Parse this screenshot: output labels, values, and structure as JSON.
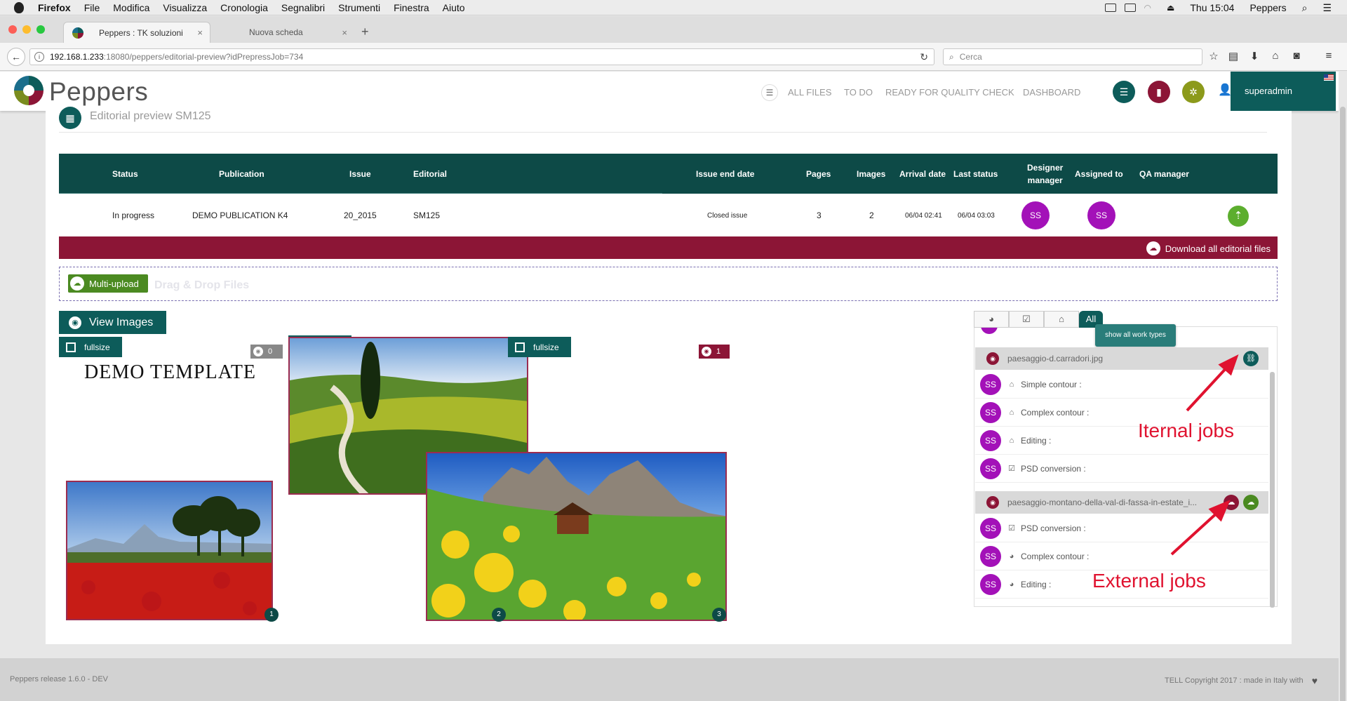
{
  "menubar": {
    "app": "Firefox",
    "items": [
      "File",
      "Modifica",
      "Visualizza",
      "Cronologia",
      "Segnalibri",
      "Strumenti",
      "Finestra",
      "Aiuto"
    ],
    "clock": "Thu 15:04",
    "user": "Peppers"
  },
  "browser": {
    "tabs": [
      {
        "label": "Peppers : TK soluzioni",
        "close": "×"
      },
      {
        "label": "Nuova scheda",
        "close": "×"
      }
    ],
    "new_tab": "+",
    "url_host": "192.168.1.233",
    "url_path": ":18080/peppers/editorial-preview?idPrepressJob=734",
    "search_placeholder": "Cerca"
  },
  "app": {
    "brand": "Peppers",
    "nav": [
      "ALL FILES",
      "TO DO",
      "READY FOR QUALITY CHECK",
      "DASHBOARD"
    ],
    "user": "superadmin",
    "header_colors": {
      "teal": "#0d5c5a",
      "crimson": "#8c1536",
      "olive": "#8c9a1b"
    }
  },
  "page": {
    "title": "Editorial preview SM125"
  },
  "table": {
    "headers": {
      "status": "Status",
      "publication": "Publication",
      "issue": "Issue",
      "editorial": "Editorial",
      "end_date": "Issue end date",
      "pages": "Pages",
      "images": "Images",
      "arrival": "Arrival date",
      "last_status": "Last status",
      "designer_a": "Designer",
      "designer_b": "manager",
      "assigned": "Assigned to",
      "qa": "QA manager"
    },
    "row": {
      "status": "In progress",
      "publication": "DEMO PUBLICATION K4",
      "issue": "20_2015",
      "editorial": "SM125",
      "end_date": "Closed issue",
      "pages": "3",
      "images": "2",
      "arrival": "06/04 02:41",
      "last_status": "06/04 03:03",
      "designer": "SS",
      "assigned": "SS"
    }
  },
  "download_label": "Download all editorial files",
  "upload": {
    "button": "Multi-upload",
    "hint": "Drag & Drop Files"
  },
  "view_images": "View Images",
  "preview": {
    "fullsize_label": "fullsize",
    "template_text": "DEMO TEMPLATE",
    "counts": [
      "0",
      "1",
      "1"
    ],
    "page_numbers": [
      "1",
      "2",
      "3"
    ]
  },
  "panel": {
    "tab_all": "All",
    "tooltip": "show all work types",
    "files": [
      {
        "name": "paesaggio-d.carradori.jpg",
        "jobs": [
          {
            "icon": "home-icon",
            "label": "Simple contour :",
            "user": "SS"
          },
          {
            "icon": "home-icon",
            "label": "Complex contour :",
            "user": "SS"
          },
          {
            "icon": "home-icon",
            "label": "Editing :",
            "user": "SS"
          },
          {
            "icon": "check-icon",
            "label": "PSD conversion :",
            "user": "SS"
          }
        ]
      },
      {
        "name": "paesaggio-montano-della-val-di-fassa-in-estate_i...",
        "jobs": [
          {
            "icon": "check-icon",
            "label": "PSD conversion :",
            "user": "SS"
          },
          {
            "icon": "globe-icon",
            "label": "Complex contour :",
            "user": "SS"
          },
          {
            "icon": "globe-icon",
            "label": "Editing :",
            "user": "SS"
          }
        ]
      }
    ]
  },
  "annotations": {
    "internal": "Iternal jobs",
    "external": "External jobs"
  },
  "footer": {
    "release": "Peppers release 1.6.0 - DEV",
    "copyright": "TELL Copyright 2017 : made in Italy with"
  }
}
